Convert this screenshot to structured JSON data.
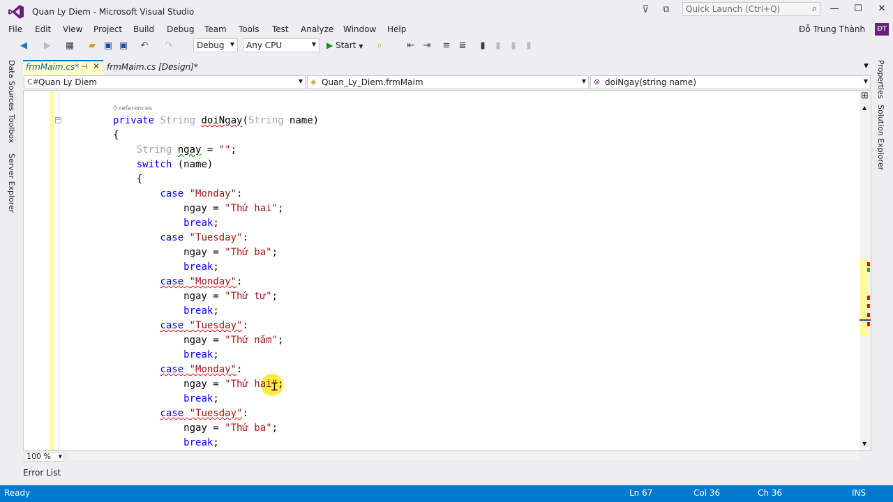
{
  "window": {
    "title": "Quan Ly Diem - Microsoft Visual Studio"
  },
  "quick_launch": {
    "placeholder": "Quick Launch (Ctrl+Q)"
  },
  "menu": [
    "File",
    "Edit",
    "View",
    "Project",
    "Build",
    "Debug",
    "Team",
    "Tools",
    "Test",
    "Analyze",
    "Window",
    "Help"
  ],
  "user": {
    "name": "Đỗ Trung Thành",
    "initials": "ĐT"
  },
  "toolbar": {
    "config": "Debug",
    "platform": "Any CPU",
    "start_label": "Start"
  },
  "side_tabs_left": [
    "Data Sources",
    "Toolbox",
    "Server Explorer"
  ],
  "side_tabs_right": [
    "Properties",
    "Solution Explorer"
  ],
  "tabs": [
    {
      "label": "frmMaim.cs*",
      "active": true
    },
    {
      "label": "frmMaim.cs [Design]*",
      "active": false
    }
  ],
  "nav": {
    "project": "Quan Ly Diem",
    "class": "Quan_Ly_Diem.frmMaim",
    "member": "doiNgay(string name)"
  },
  "code": {
    "references": "0 references",
    "lines": {
      "l1_kw": "private",
      "l1_type": "String",
      "l1_name": "doiNgay",
      "l1_ptype": "String",
      "l1_param": "name",
      "cases": [
        {
          "label": "\"Monday\"",
          "value": "\"Thứ hai\""
        },
        {
          "label": "\"Tuesday\"",
          "value": "\"Thứ ba\""
        },
        {
          "label": "\"Monday\"",
          "value": "\"Thứ tư\""
        },
        {
          "label": "\"Tuesday\"",
          "value": "\"Thứ năm\""
        },
        {
          "label": "\"Monday\"",
          "value": "\"Thứ hai\""
        },
        {
          "label": "\"Tuesday\"",
          "value": "\"Thứ ba\""
        }
      ]
    }
  },
  "zoom": "100 %",
  "error_list_label": "Error List",
  "status": {
    "ready": "Ready",
    "ln": "Ln 67",
    "col": "Col 36",
    "ch": "Ch 36",
    "mode": "INS"
  },
  "colors": {
    "accent": "#007acc",
    "keyword": "#0000ff",
    "string": "#a31515",
    "brand": "#68217a"
  }
}
